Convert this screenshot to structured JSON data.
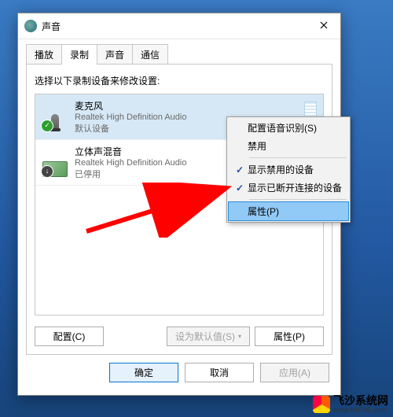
{
  "window": {
    "title": "声音"
  },
  "tabs": [
    {
      "label": "播放",
      "active": false
    },
    {
      "label": "录制",
      "active": true
    },
    {
      "label": "声音",
      "active": false
    },
    {
      "label": "通信",
      "active": false
    }
  ],
  "instruction": "选择以下录制设备来修改设置:",
  "devices": [
    {
      "name": "麦克风",
      "driver": "Realtek High Definition Audio",
      "status": "默认设备",
      "selected": true,
      "icon": "mic-icon",
      "badge": "check"
    },
    {
      "name": "立体声混音",
      "driver": "Realtek High Definition Audio",
      "status": "已停用",
      "selected": false,
      "icon": "sound-card-icon",
      "badge": "down"
    }
  ],
  "context_menu": [
    {
      "label": "配置语音识别(S)",
      "checked": false
    },
    {
      "label": "禁用",
      "checked": false
    },
    {
      "sep": true
    },
    {
      "label": "显示禁用的设备",
      "checked": true
    },
    {
      "label": "显示已断开连接的设备",
      "checked": true
    },
    {
      "sep": true
    },
    {
      "label": "属性(P)",
      "checked": false,
      "highlight": true
    }
  ],
  "panel_buttons": {
    "configure": "配置(C)",
    "set_default": "设为默认值(S)",
    "properties": "属性(P)"
  },
  "dialog_buttons": {
    "ok": "确定",
    "cancel": "取消",
    "apply": "应用(A)"
  },
  "watermark": {
    "name": "飞沙系统网",
    "url": "www.fs0745.com"
  }
}
